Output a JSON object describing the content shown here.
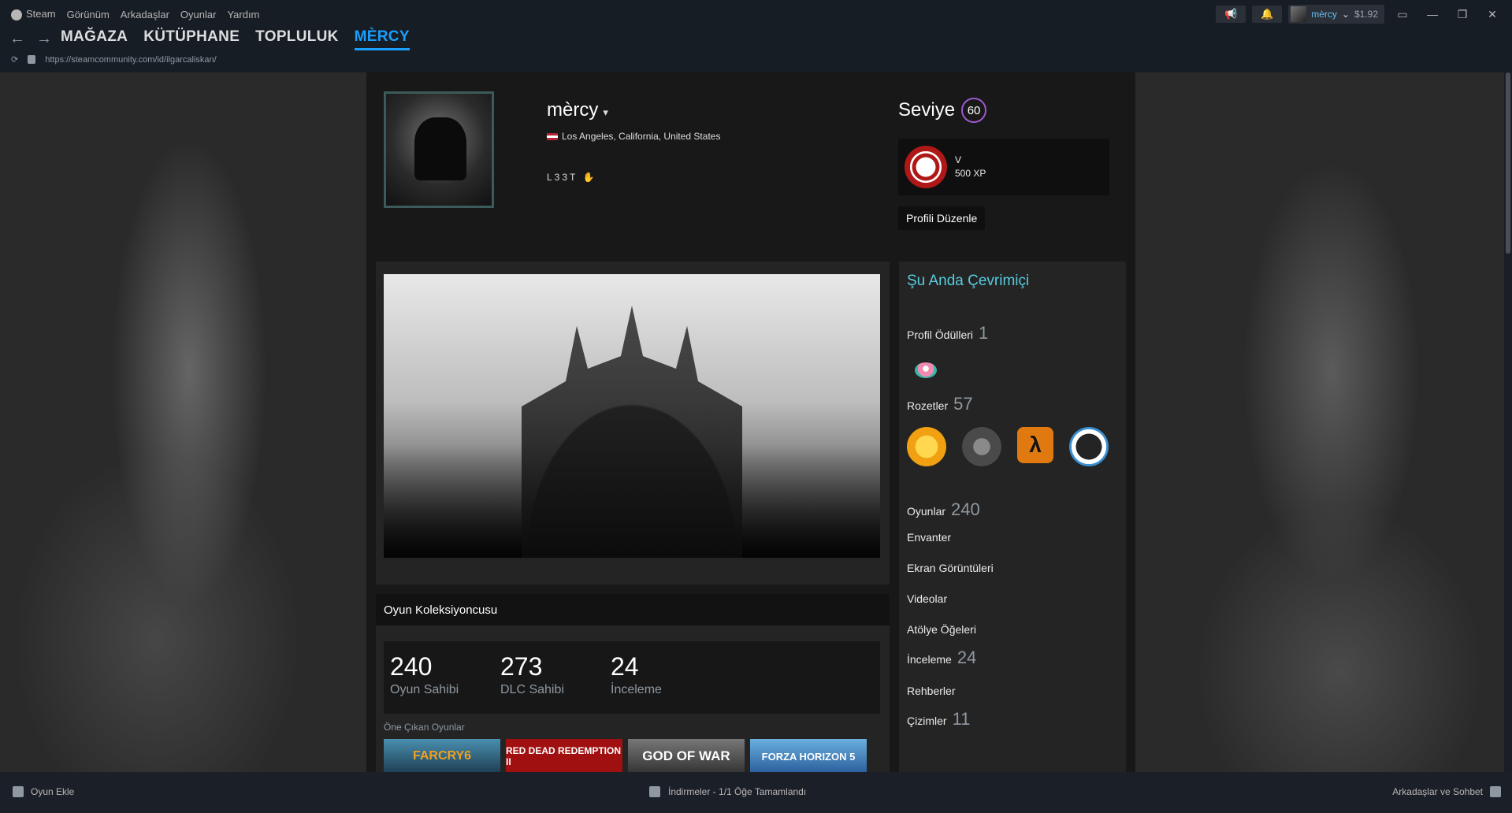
{
  "menu": {
    "items": [
      "Steam",
      "Görünüm",
      "Arkadaşlar",
      "Oyunlar",
      "Yardım"
    ]
  },
  "account": {
    "name": "mèrcy",
    "balance": "$1.92"
  },
  "nav": {
    "tabs": [
      "MAĞAZA",
      "KÜTÜPHANE",
      "TOPLULUK",
      "MÈRCY"
    ],
    "active_index": 3,
    "url": "https://steamcommunity.com/id/ilgarcaliskan/"
  },
  "profile": {
    "name": "mèrcy",
    "location": "Los Angeles, California, United States",
    "summary": "L33T",
    "level_label": "Seviye",
    "level": "60",
    "badge": {
      "title": "V",
      "xp": "500 XP"
    },
    "edit_button": "Profili Düzenle"
  },
  "collector": {
    "title": "Oyun Koleksiyoncusu",
    "stats": [
      {
        "value": "240",
        "label": "Oyun Sahibi"
      },
      {
        "value": "273",
        "label": "DLC Sahibi"
      },
      {
        "value": "24",
        "label": "İnceleme"
      }
    ],
    "featured_label": "Öne Çıkan Oyunlar",
    "games": [
      "FARCRY6",
      "RED DEAD REDEMPTION II",
      "GOD OF WAR",
      "FORZA HORIZON 5"
    ]
  },
  "sidebar": {
    "online_status": "Şu Anda Çevrimiçi",
    "awards": {
      "label": "Profil Ödülleri",
      "count": "1"
    },
    "badges": {
      "label": "Rozetler",
      "count": "57"
    },
    "games": {
      "label": "Oyunlar",
      "count": "240"
    },
    "inventory": "Envanter",
    "screenshots": "Ekran Görüntüleri",
    "videos": "Videolar",
    "workshop": "Atölye Öğeleri",
    "reviews": {
      "label": "İnceleme",
      "count": "24"
    },
    "guides": "Rehberler",
    "artwork": {
      "label": "Çizimler",
      "count": "11"
    }
  },
  "statusbar": {
    "add_game": "Oyun Ekle",
    "downloads": "İndirmeler - 1/1 Öğe Tamamlandı",
    "friends": "Arkadaşlar ve Sohbet"
  }
}
